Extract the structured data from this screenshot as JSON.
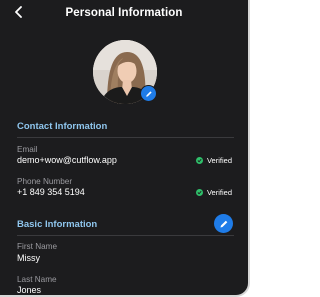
{
  "header": {
    "title": "Personal Information",
    "back_icon": "chevron-left-icon"
  },
  "profile": {
    "edit_icon": "pencil-icon"
  },
  "contact": {
    "heading": "Contact Information",
    "email": {
      "label": "Email",
      "value": "demo+wow@cutflow.app",
      "status": "Verified"
    },
    "phone": {
      "label": "Phone Number",
      "value": "+1 849 354 5194",
      "status": "Verified"
    }
  },
  "basic": {
    "heading": "Basic Information",
    "edit_icon": "pencil-icon",
    "first_name": {
      "label": "First Name",
      "value": "Missy"
    },
    "last_name": {
      "label": "Last Name",
      "value": "Jones"
    }
  },
  "colors": {
    "background": "#1c1c1e",
    "section_heading": "#8fc6ee",
    "accent": "#1f7ce8",
    "verified": "#2fbf6a"
  }
}
